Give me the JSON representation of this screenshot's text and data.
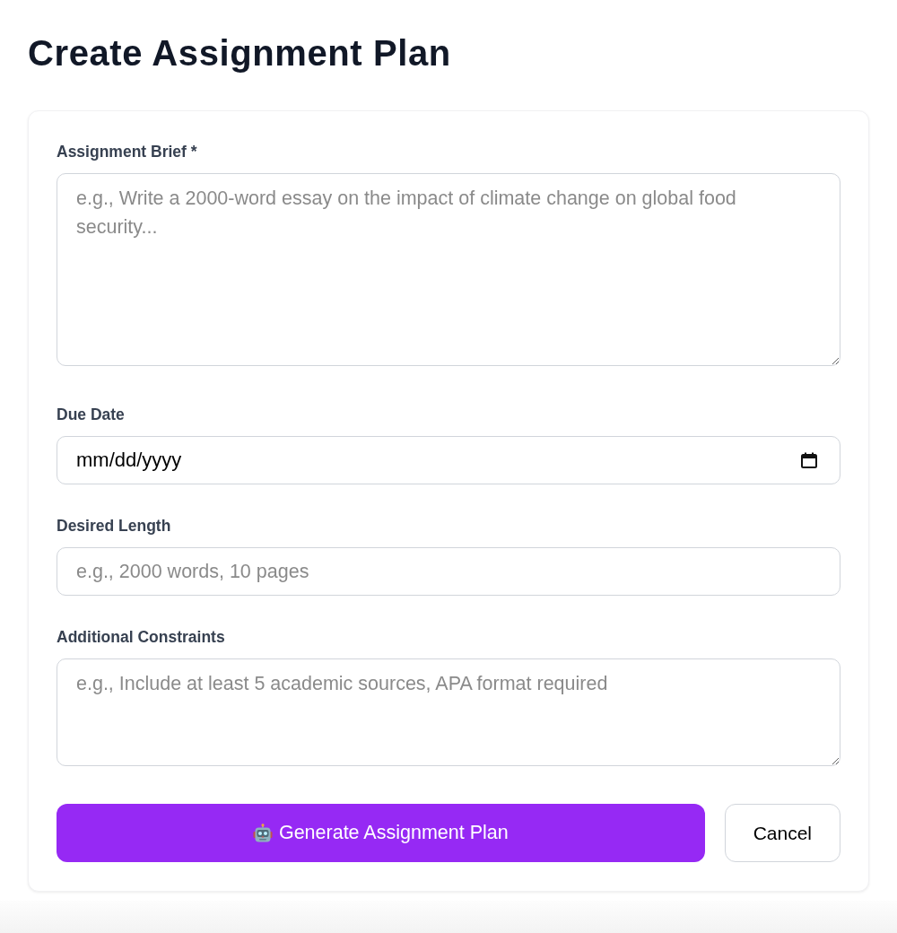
{
  "title": "Create Assignment Plan",
  "form": {
    "fields": [
      {
        "kind": "longtext",
        "label": "Assignment Brief *",
        "placeholder": "e.g., Write a 2000-word essay on the impact of climate change on global food security..."
      },
      {
        "kind": "date",
        "label": "Due Date",
        "placeholder": "mm/dd/yyyy"
      },
      {
        "kind": "text",
        "label": "Desired Length",
        "placeholder": "e.g., 2000 words, 10 pages"
      },
      {
        "kind": "textarea",
        "label": "Additional Constraints",
        "placeholder": "e.g., Include at least 5 academic sources, APA format required"
      }
    ],
    "buttons": [
      {
        "kind": "primary",
        "label": "Generate Assignment Plan"
      },
      {
        "kind": "secondary",
        "label": "Cancel"
      }
    ]
  }
}
